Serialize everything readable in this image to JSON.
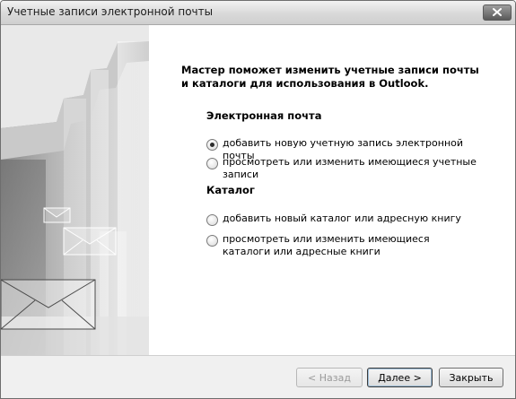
{
  "window": {
    "title": "Учетные записи электронной почты"
  },
  "intro": "Мастер поможет изменить учетные записи почты и каталоги для использования в Outlook.",
  "email_section": {
    "title": "Электронная почта",
    "options": [
      {
        "label": "добавить новую учетную запись электронной почты",
        "checked": true
      },
      {
        "label": "просмотреть или изменить имеющиеся учетные записи",
        "checked": false
      }
    ]
  },
  "directory_section": {
    "title": "Каталог",
    "options": [
      {
        "label": "добавить новый каталог или адресную книгу",
        "checked": false
      },
      {
        "label": "просмотреть или изменить имеющиеся каталоги или адресные книги",
        "checked": false
      }
    ]
  },
  "buttons": {
    "back": "< Назад",
    "next": "Далее >",
    "close": "Закрыть"
  }
}
